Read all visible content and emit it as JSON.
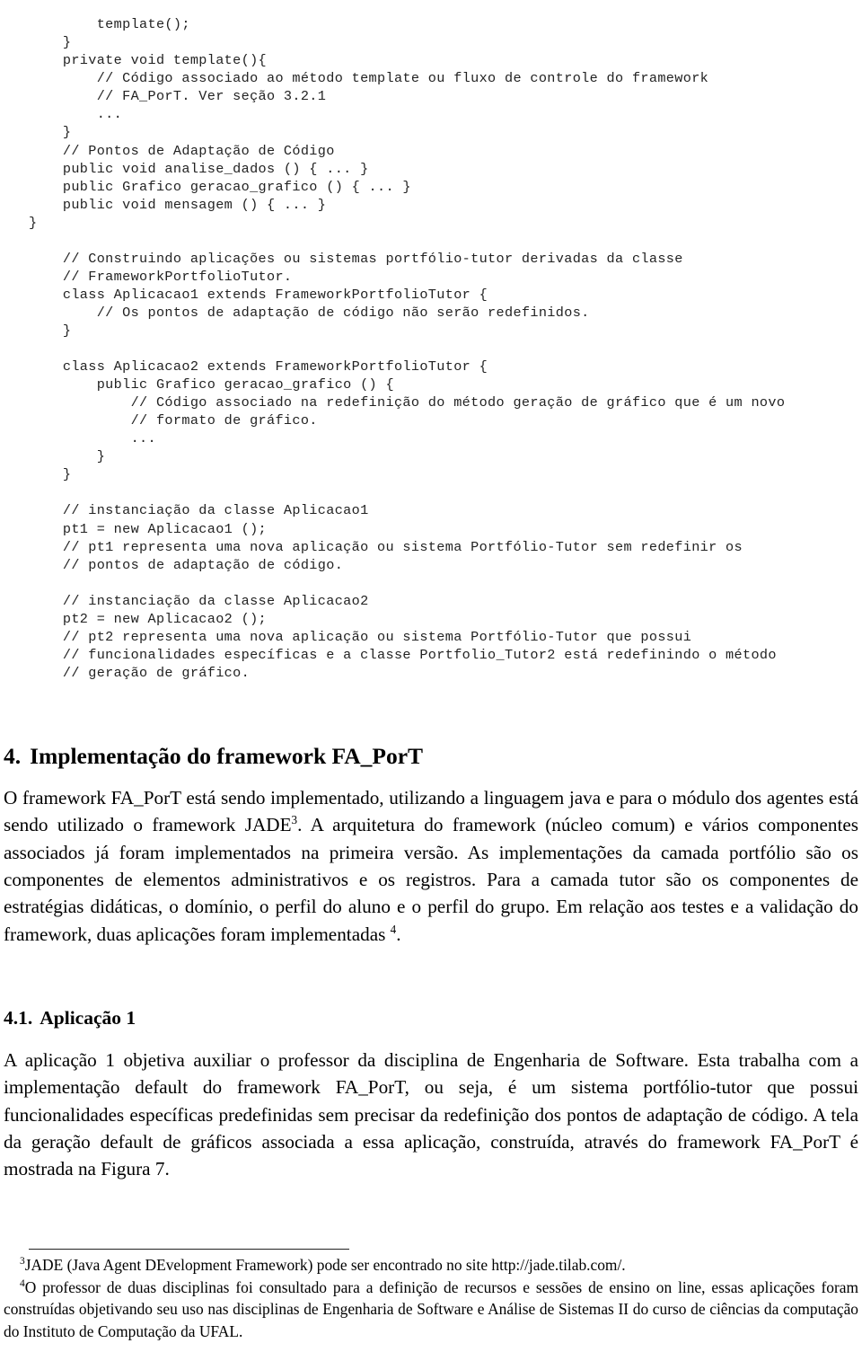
{
  "document": {
    "page_kind": "academic-paper-page",
    "language": "pt-BR"
  },
  "code_listing": {
    "name": "java-code-listing",
    "lines": [
      "        template();",
      "    }",
      "    private void template(){",
      "        // Código associado ao método template ou fluxo de controle do framework",
      "        // FA_PorT. Ver seção 3.2.1",
      "        ...",
      "    }",
      "    // Pontos de Adaptação de Código",
      "    public void analise_dados () { ... }",
      "    public Grafico geracao_grafico () { ... }",
      "    public void mensagem () { ... }",
      "}",
      "",
      "    // Construindo aplicações ou sistemas portfólio-tutor derivadas da classe",
      "    // FrameworkPortfolioTutor.",
      "    class Aplicacao1 extends FrameworkPortfolioTutor {",
      "        // Os pontos de adaptação de código não serão redefinidos.",
      "    }",
      "",
      "    class Aplicacao2 extends FrameworkPortfolioTutor {",
      "        public Grafico geracao_grafico () {",
      "            // Código associado na redefinição do método geração de gráfico que é um novo",
      "            // formato de gráfico.",
      "            ...",
      "        }",
      "    }",
      "",
      "    // instanciação da classe Aplicacao1",
      "    pt1 = new Aplicacao1 ();",
      "    // pt1 representa uma nova aplicação ou sistema Portfólio-Tutor sem redefinir os",
      "    // pontos de adaptação de código.",
      "",
      "    // instanciação da classe Aplicacao2",
      "    pt2 = new Aplicacao2 ();",
      "    // pt2 representa uma nova aplicação ou sistema Portfólio-Tutor que possui",
      "    // funcionalidades específicas e a classe Portfolio_Tutor2 está redefinindo o método",
      "    // geração de gráfico."
    ]
  },
  "section4": {
    "number": "4.",
    "title": "Implementação do framework FA_PorT",
    "paragraph": {
      "part1": "O framework FA_PorT está sendo implementado, utilizando a linguagem java e para o módulo dos agentes está sendo utilizado o framework JADE",
      "sup1": "3",
      "part2": ". A arquitetura do framework (núcleo comum) e vários componentes associados já foram implementados na primeira versão. As implementações da camada portfólio são os componentes de elementos administrativos e os registros. Para a camada tutor são os componentes de estratégias didáticas, o domínio, o perfil do aluno e o perfil do grupo. Em relação aos testes e a validação do framework, duas aplicações foram implementadas ",
      "sup2": "4",
      "part3": "."
    }
  },
  "section41": {
    "number": "4.1.",
    "title": "Aplicação 1",
    "paragraph": "A aplicação 1 objetiva auxiliar o professor da disciplina de Engenharia de Software. Esta trabalha com a implementação default do framework FA_PorT, ou seja, é um sistema portfólio-tutor que possui funcionalidades específicas predefinidas sem precisar da redefinição dos pontos de adaptação de código. A tela da geração default de gráficos associada a essa aplicação, construída, através do framework FA_PorT é mostrada na Figura 7."
  },
  "footnotes": {
    "items": [
      {
        "marker": "3",
        "text": "JADE (Java Agent DEvelopment Framework) pode ser encontrado no site http://jade.tilab.com/."
      },
      {
        "marker": "4",
        "text": "O professor de duas disciplinas foi consultado para a definição de recursos e sessões de ensino on line, essas aplicações foram construídas objetivando seu uso nas disciplinas de Engenharia de Software e Análise de Sistemas II do curso de ciências da computação do Instituto de Computação da UFAL."
      }
    ]
  },
  "colors": {
    "page_background": "#ffffff",
    "body_text": "#000000",
    "code_text": "#222222",
    "rule": "#222222"
  }
}
